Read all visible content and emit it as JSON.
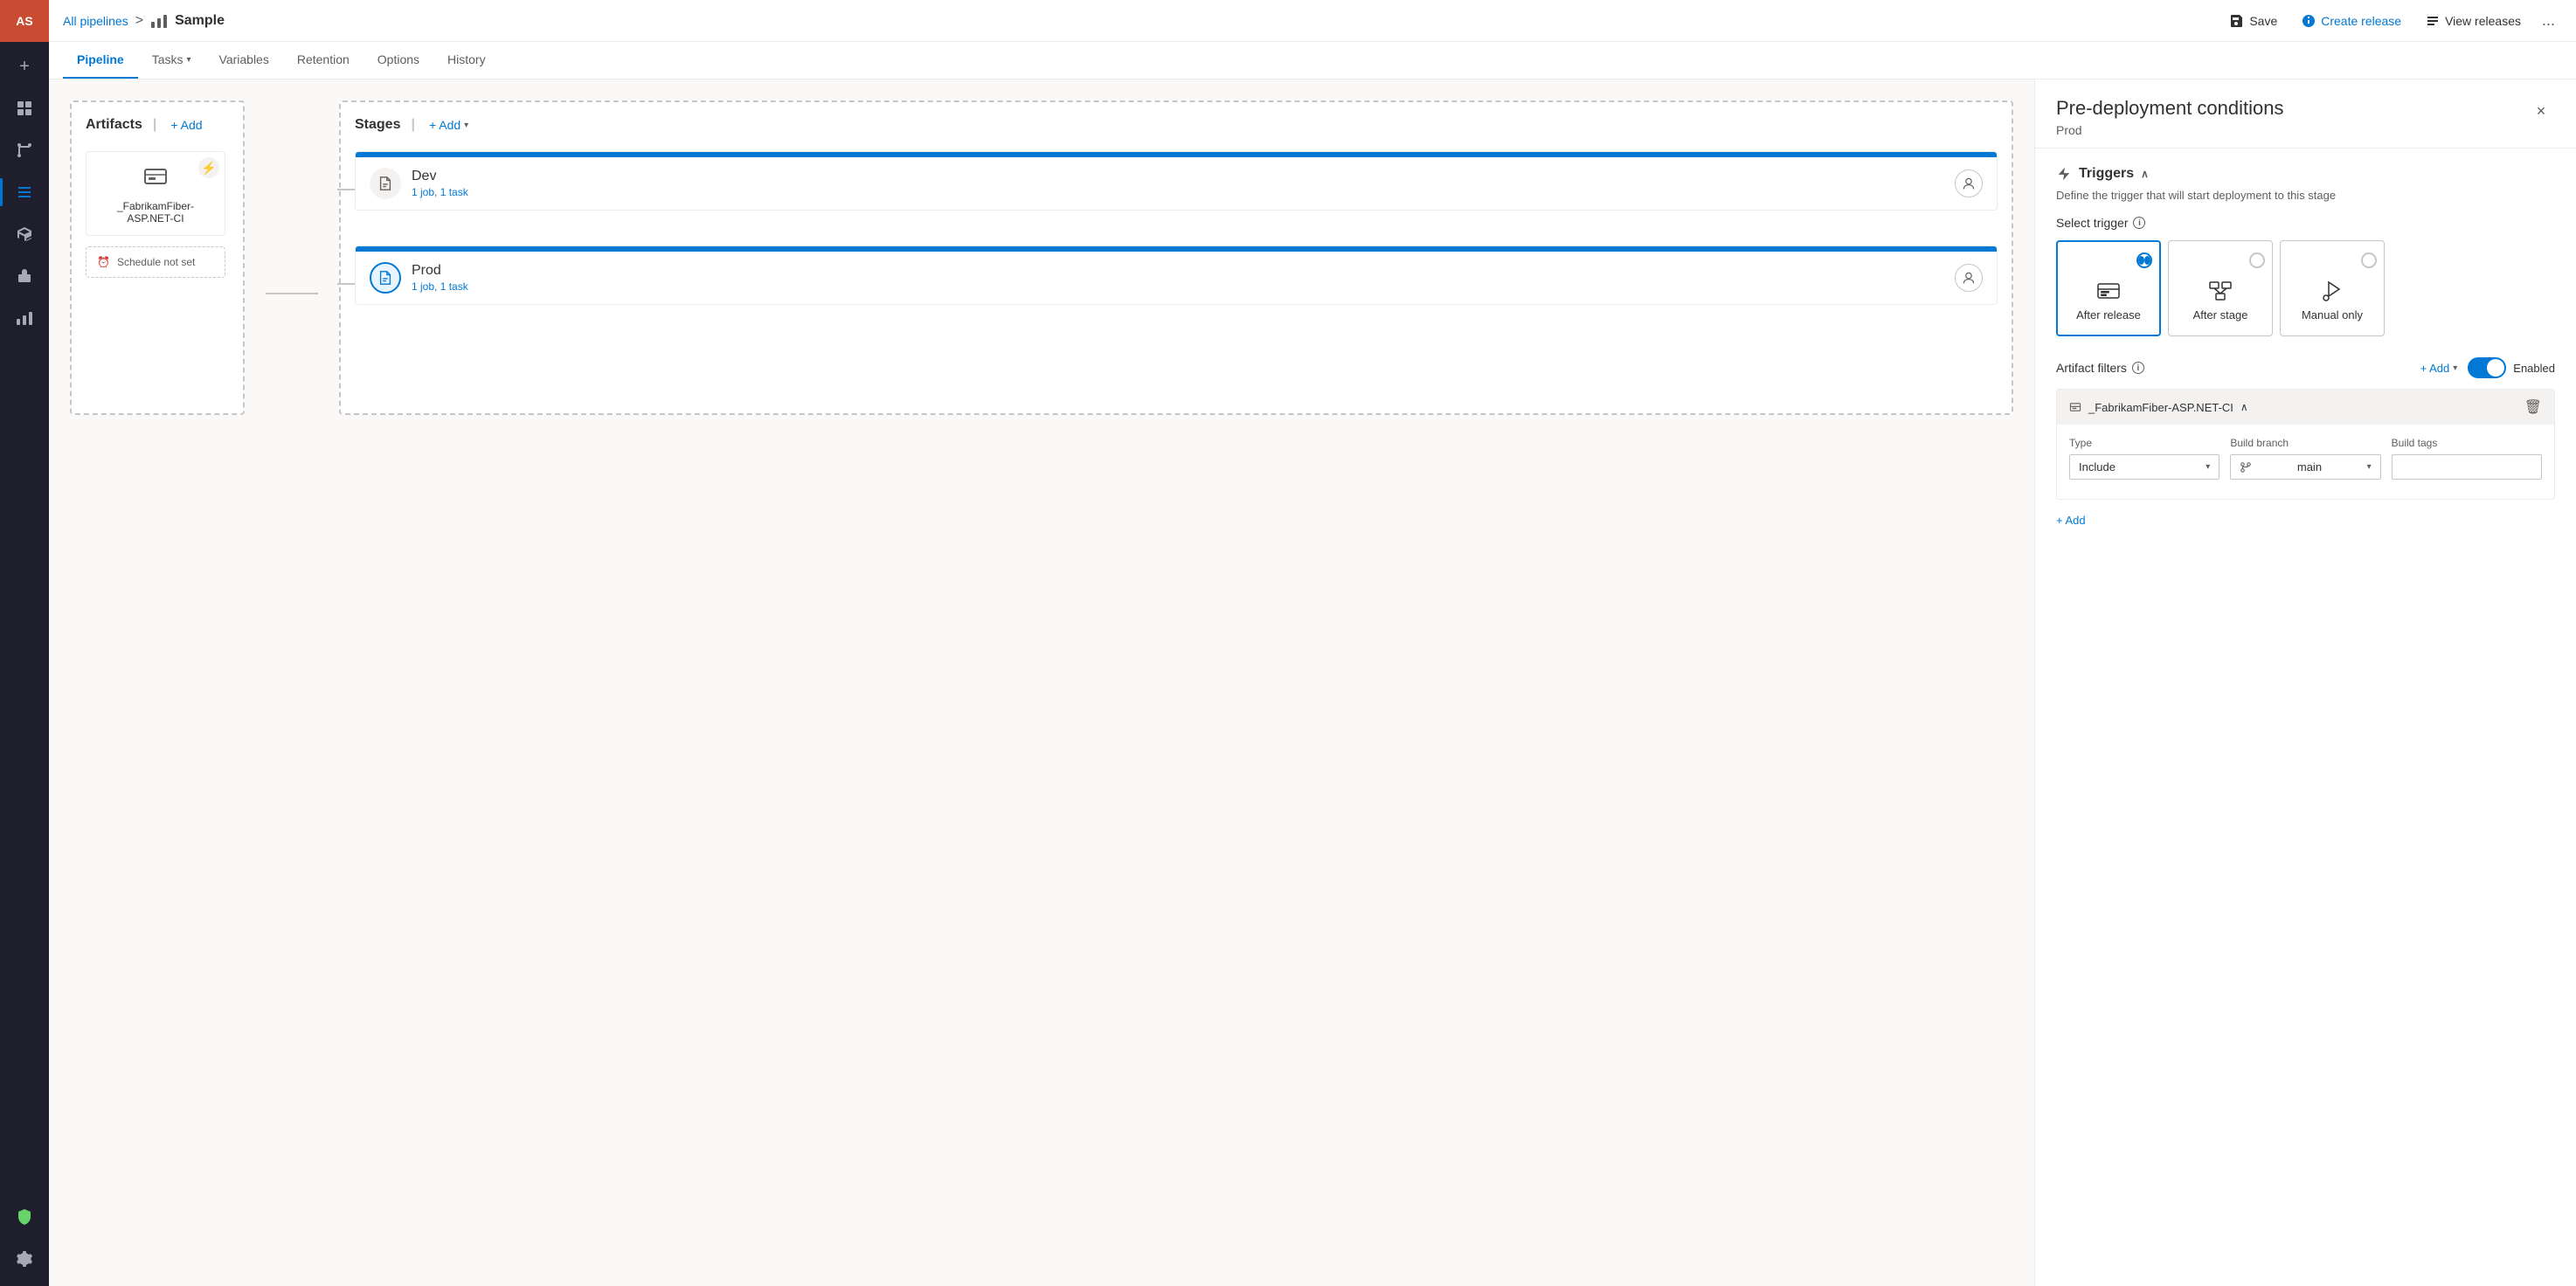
{
  "app": {
    "avatar": "AS",
    "avatar_bg": "#c84b32"
  },
  "header": {
    "breadcrumb": "All pipelines",
    "separator": ">",
    "pipeline_icon": "pipeline-icon",
    "title": "Sample",
    "save_label": "Save",
    "create_release_label": "Create release",
    "view_releases_label": "View releases",
    "more_label": "..."
  },
  "tabs": [
    {
      "id": "pipeline",
      "label": "Pipeline",
      "active": true
    },
    {
      "id": "tasks",
      "label": "Tasks",
      "has_dropdown": true,
      "active": false
    },
    {
      "id": "variables",
      "label": "Variables",
      "active": false
    },
    {
      "id": "retention",
      "label": "Retention",
      "active": false
    },
    {
      "id": "options",
      "label": "Options",
      "active": false
    },
    {
      "id": "history",
      "label": "History",
      "active": false
    }
  ],
  "canvas": {
    "artifacts_title": "Artifacts",
    "artifacts_add": "+ Add",
    "stages_title": "Stages",
    "stages_add": "+ Add",
    "artifact_name": "_FabrikamFiber-ASP.NET-CI",
    "schedule_label": "Schedule not set",
    "dev_stage": {
      "name": "Dev",
      "meta": "1 job, 1 task"
    },
    "prod_stage": {
      "name": "Prod",
      "meta": "1 job, 1 task"
    }
  },
  "panel": {
    "title": "Pre-deployment conditions",
    "subtitle": "Prod",
    "close_label": "×",
    "triggers_section": "Triggers",
    "triggers_desc": "Define the trigger that will start deployment to this stage",
    "select_trigger_label": "Select trigger",
    "trigger_options": [
      {
        "id": "after-release",
        "label": "After release",
        "selected": true,
        "icon": "after-release-icon"
      },
      {
        "id": "after-stage",
        "label": "After stage",
        "selected": false,
        "icon": "after-stage-icon"
      },
      {
        "id": "manual-only",
        "label": "Manual only",
        "selected": false,
        "icon": "manual-only-icon"
      }
    ],
    "artifact_filters_title": "Artifact filters",
    "add_label": "+ Add",
    "enabled_label": "Enabled",
    "filter_artifact_name": "_FabrikamFiber-ASP.NET-CI",
    "type_label": "Type",
    "build_branch_label": "Build branch",
    "build_tags_label": "Build tags",
    "type_value": "Include",
    "branch_value": "main",
    "filter_add_label": "+ Add"
  },
  "sidebar_items": [
    {
      "id": "boards",
      "icon": "boards-icon"
    },
    {
      "id": "repos",
      "icon": "repos-icon"
    },
    {
      "id": "pipelines",
      "icon": "pipelines-icon",
      "active": true
    },
    {
      "id": "testplans",
      "icon": "testplans-icon"
    },
    {
      "id": "artifacts",
      "icon": "artifacts-icon"
    },
    {
      "id": "deploy",
      "icon": "deploy-icon"
    }
  ]
}
